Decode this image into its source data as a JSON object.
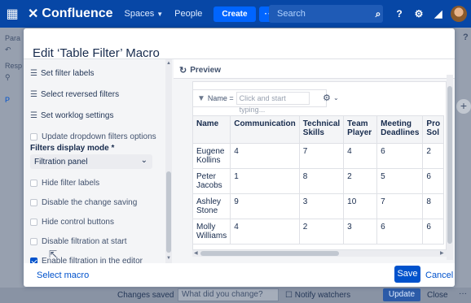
{
  "topnav": {
    "logo_text": "Confluence",
    "spaces_label": "Spaces",
    "people_label": "People",
    "create_label": "Create",
    "more_label": "···",
    "search_placeholder": "Search",
    "help_icon": "?",
    "settings_icon": "⚙",
    "notifications_icon": "🔔"
  },
  "background": {
    "left_text_1": "Para",
    "left_text_2": "Resp",
    "left_text_3": "P",
    "question": "?",
    "plus": "+",
    "changes_saved": "Changes saved",
    "what_did_you_change": "What did you change?",
    "notify_watchers": "Notify watchers",
    "update_label": "Update",
    "close_label": "Close",
    "dots": "···"
  },
  "dialog": {
    "title": "Edit ‘Table Filter’ Macro",
    "left_panel": {
      "set_filter_labels": "Set filter labels",
      "select_reversed_filters": "Select reversed filters",
      "set_worklog_settings": "Set worklog settings",
      "update_dropdown_filters": "Update dropdown filters options",
      "filters_display_mode_label": "Filters display mode *",
      "filters_display_mode_value": "Filtration panel",
      "hide_filter_labels": "Hide filter labels",
      "disable_change_saving": "Disable the change saving",
      "hide_control_buttons": "Hide control buttons",
      "disable_filtration_at_start": "Disable filtration at start",
      "enable_filtration_in_editor": "Enable filtration in the editor",
      "enable_filtration_checked": true
    },
    "preview": {
      "heading": "Preview",
      "filter_label": "Name =",
      "filter_placeholder": "Click and start typing...",
      "table": {
        "headers": [
          "Name",
          "Communication",
          "Technical Skills",
          "Team Player",
          "Meeting Deadlines",
          "Pro Sol"
        ],
        "rows": [
          [
            "Eugene Kollins",
            "4",
            "7",
            "4",
            "6",
            "2"
          ],
          [
            "Peter Jacobs",
            "1",
            "8",
            "2",
            "5",
            "6"
          ],
          [
            "Ashley Stone",
            "9",
            "3",
            "10",
            "7",
            "8"
          ],
          [
            "Molly Williams",
            "4",
            "2",
            "3",
            "6",
            "6"
          ]
        ]
      }
    },
    "footer": {
      "select_macro": "Select macro",
      "save_label": "Save",
      "cancel_label": "Cancel"
    }
  }
}
